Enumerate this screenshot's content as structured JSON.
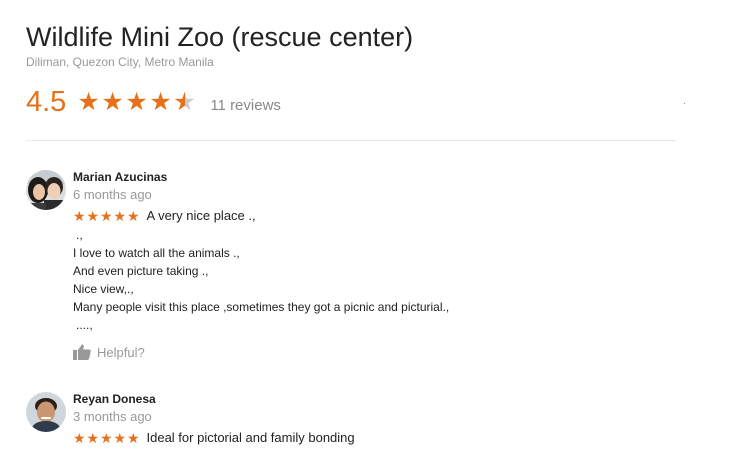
{
  "place": {
    "title": "Wildlife Mini Zoo (rescue center)",
    "address": "Diliman, Quezon City, Metro Manila",
    "rating": "4.5",
    "rating_value": 4.5,
    "stars_max": 5,
    "review_count": "11 reviews"
  },
  "colors": {
    "accent": "#e7711b",
    "muted": "#999999",
    "text": "#222222"
  },
  "reviews": [
    {
      "author": "Marian Azucinas",
      "when": "6 months ago",
      "stars": 5,
      "first_line": "A very nice place .,",
      "lines": [
        ".,",
        "I love to watch all the animals .,",
        "And even picture taking .,",
        "Nice view,.,",
        "Many people visit this place ,sometimes they got a picnic and picturial.,",
        "....,"
      ],
      "helpful_label": "Helpful?",
      "helpful_icon": "thumbs-up-icon"
    },
    {
      "author": "Reyan Donesa",
      "when": "3 months ago",
      "stars": 5,
      "first_line": "Ideal for pictorial and family bonding"
    }
  ]
}
